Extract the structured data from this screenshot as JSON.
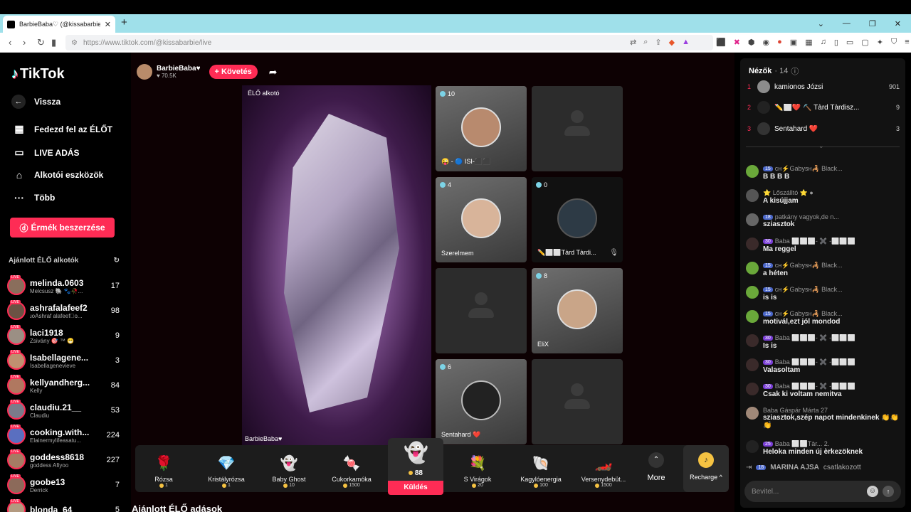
{
  "browser": {
    "tab_title": "BarbieBaba♡ (@kissabarbie",
    "url": "https://www.tiktok.com/@kissabarbie/live"
  },
  "sidebar": {
    "logo": "TikTok",
    "back": "Vissza",
    "menu": [
      {
        "label": "Fedezd fel az ÉLŐT",
        "icon": "calendar-icon"
      },
      {
        "label": "LIVE ADÁS",
        "icon": "video-camera-icon"
      },
      {
        "label": "Alkotói eszközök",
        "icon": "lightbulb-icon"
      },
      {
        "label": "Több",
        "icon": "more-dots-icon"
      }
    ],
    "coin_button": "Érmék beszerzése",
    "recommended_title": "Ajánlott ÉLŐ alkotók",
    "creators": [
      {
        "name": "melinda.0603",
        "sub": "Melcsusz 🐘 🐾🥀...",
        "count": "17"
      },
      {
        "name": "ashrafalafeef2",
        "sub": "ɹoAshraf alafeef\u0000o...",
        "count": "98"
      },
      {
        "name": "laci1918",
        "sub": "Zsivány 🎯 ™ 😁",
        "count": "9"
      },
      {
        "name": "Isabellagene...",
        "sub": "Isabellagenevieve",
        "count": "3"
      },
      {
        "name": "kellyandherg...",
        "sub": "Kelly",
        "count": "84"
      },
      {
        "name": "claudiu.21__",
        "sub": "Claudiu",
        "count": "53"
      },
      {
        "name": "cooking.with...",
        "sub": "Elainermylifeasatu...",
        "count": "224"
      },
      {
        "name": "goddess8618",
        "sub": "goddess Afiyoo",
        "count": "227"
      },
      {
        "name": "goobe13",
        "sub": "Derrick",
        "count": "7"
      },
      {
        "name": "blonda_64",
        "sub": "",
        "count": "5"
      }
    ]
  },
  "host": {
    "name": "BarbieBaba♥",
    "likes": "♥ 70.5K",
    "follow": "+ Követés"
  },
  "stage": {
    "label": "ÉLŐ alkotó",
    "name": "BarbieBaba♥"
  },
  "guests": [
    {
      "count": "10",
      "name": "😜 - 🔵 ISI-⬛⬛"
    },
    {
      "count": "",
      "name": ""
    },
    {
      "count": "4",
      "name": "Szerelmem"
    },
    {
      "count": "0",
      "name": "✏️⬜⬜Tàrd Tàrdi..."
    },
    {
      "count": "",
      "name": ""
    },
    {
      "count": "8",
      "name": "EliX"
    },
    {
      "count": "6",
      "name": "Sentahard ❤️"
    },
    {
      "count": "",
      "name": ""
    }
  ],
  "gifts": [
    {
      "name": "Rózsa",
      "price": "1",
      "icon": "🌹"
    },
    {
      "name": "Kristályrózsa",
      "price": "1",
      "icon": "💎"
    },
    {
      "name": "Baby Ghost",
      "price": "10",
      "icon": "👻"
    },
    {
      "name": "Cukorkamóka",
      "price": "1500",
      "icon": "🍬"
    },
    {
      "name": "S Virágok",
      "price": "20",
      "icon": "💐"
    },
    {
      "name": "Kagylóenergia",
      "price": "100",
      "icon": "🐚"
    },
    {
      "name": "Versenydebüt...",
      "price": "1500",
      "icon": "🏎️"
    }
  ],
  "selected_gift": {
    "price": "88",
    "send": "Küldés",
    "icon": "👻"
  },
  "more_label": "More",
  "recharge_label": "Recharge ^",
  "recommended_live": "Ajánlott ÉLŐ adások",
  "viewers": {
    "title": "Nézők",
    "count": "· 14",
    "top": [
      {
        "rank": "1",
        "name": "kamionos Józsi",
        "score": "901"
      },
      {
        "rank": "2",
        "name": "✏️⬜❤️ ⛏️ Tàrd Tàrdisz...",
        "score": "9"
      },
      {
        "rank": "3",
        "name": "Sentahard ❤️",
        "score": "3"
      }
    ]
  },
  "chat": [
    {
      "level": "15",
      "user": "ᴄʜ⚡Gabysʜ🦂 Black...",
      "text": "B B B B"
    },
    {
      "level": "",
      "user": "⭐ Lőszálltó ⭐ ●",
      "text": "A kisújjam"
    },
    {
      "level": "18",
      "user": "patkány vagyok,de n...",
      "text": "sziasztok"
    },
    {
      "level": "30",
      "user": "Baba ⬜⬜⬜- ✖️ -⬜⬜⬜",
      "text": "Ma reggel"
    },
    {
      "level": "15",
      "user": "ᴄʜ⚡Gabysʜ🦂 Black...",
      "text": "a héten"
    },
    {
      "level": "15",
      "user": "ᴄʜ⚡Gabysʜ🦂 Black...",
      "text": "is is"
    },
    {
      "level": "15",
      "user": "ᴄʜ⚡Gabysʜ🦂 Black...",
      "text": "motivál,ezt jól mondod"
    },
    {
      "level": "30",
      "user": "Baba ⬜⬜⬜- ✖️ -⬜⬜⬜",
      "text": "Is is"
    },
    {
      "level": "30",
      "user": "Baba ⬜⬜⬜- ✖️ -⬜⬜⬜",
      "text": "Valasoltam"
    },
    {
      "level": "30",
      "user": "Baba ⬜⬜⬜- ✖️ -⬜⬜⬜",
      "text": "Csak ki voltam nemitva"
    },
    {
      "level": "",
      "user": "Baba Gáspár Márta 27",
      "text": "sziasztok,szép napot mindenkinek 👏👏👏"
    },
    {
      "level": "25",
      "user": "Baba ⬜⬜Tàr... 2.",
      "text": "Heloka minden új èrkezöknek"
    }
  ],
  "join": {
    "level": "18",
    "user": "MARINA AJSA",
    "text": "csatlakozott"
  },
  "chat_input_placeholder": "Bevitel..."
}
